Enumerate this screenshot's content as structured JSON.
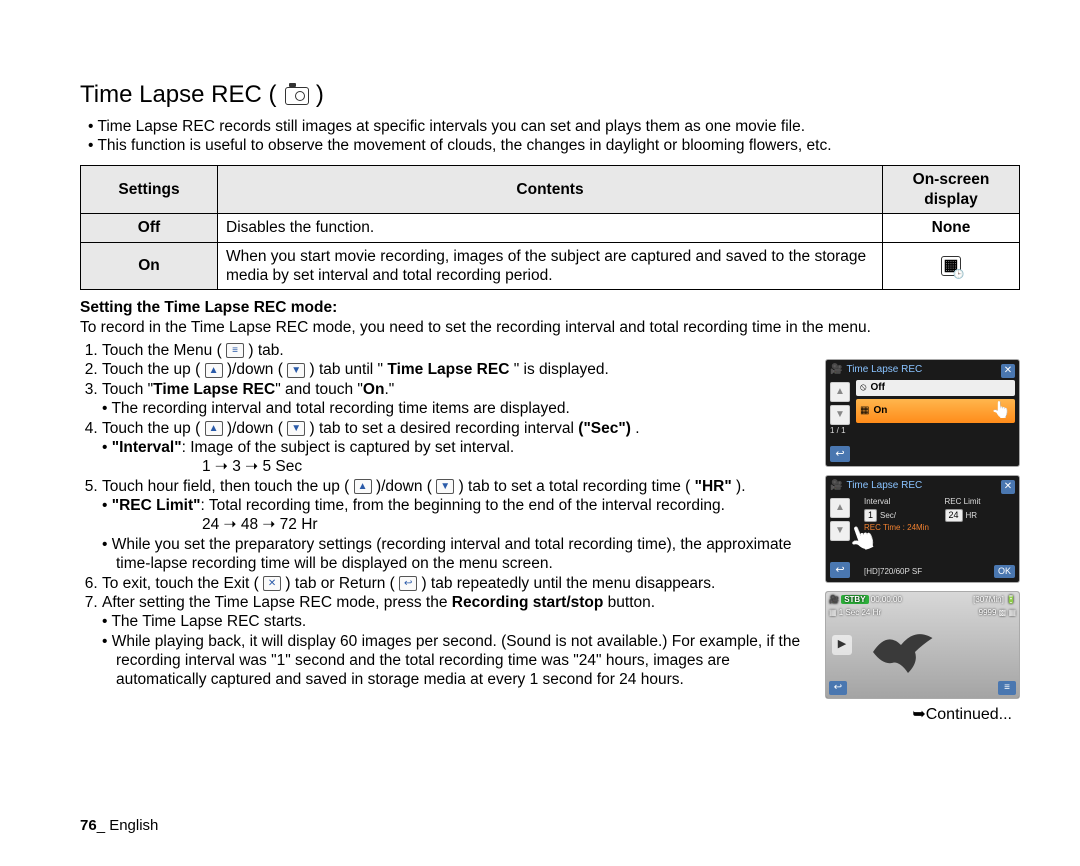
{
  "title": "Time Lapse REC (",
  "title_end": ")",
  "intro": [
    "Time Lapse REC records still images at specific intervals you can set and plays them as one movie file.",
    "This function is useful to observe the movement of clouds, the changes in daylight or blooming flowers, etc."
  ],
  "table": {
    "headers": [
      "Settings",
      "Contents",
      "On-screen display"
    ],
    "rows": [
      {
        "setting": "Off",
        "content": "Disables the function.",
        "display": "None"
      },
      {
        "setting": "On",
        "content": "When you start movie recording, images of the subject are captured and saved to the storage media by set interval and total recording period.",
        "display": "__icon__"
      }
    ]
  },
  "subhead": "Setting the Time Lapse REC mode:",
  "subtext": "To record in the Time Lapse REC mode, you need to set the recording interval and total recording time in the menu.",
  "steps": {
    "s1_a": "Touch the Menu (",
    "s1_b": ") tab.",
    "s2_a": "Touch the up (",
    "s2_b": ")/down (",
    "s2_c": ") tab until \"",
    "s2_bold": "Time Lapse REC",
    "s2_d": "\" is displayed.",
    "s3_a": "Touch \"",
    "s3_b1": "Time Lapse REC",
    "s3_b": "\" and touch \"",
    "s3_b2": "On",
    "s3_c": ".\"",
    "s3_sub": "The recording interval and total recording time items are displayed.",
    "s4_a": "Touch the up (",
    "s4_b": ")/down (",
    "s4_c": ") tab to set a desired recording interval ",
    "s4_bold": "(\"Sec\")",
    "s4_d": ".",
    "s4_sub_b": "\"Interval\"",
    "s4_sub": ": Image of the subject is captured by set interval.",
    "s4_seq": "1 ➝ 3 ➝ 5 Sec",
    "s5_a": "Touch hour field, then touch the up (",
    "s5_b": ")/down (",
    "s5_c": ") tab to set a total recording time (",
    "s5_bold": "\"HR\"",
    "s5_d": ").",
    "s5_sub_b": "\"REC Limit\"",
    "s5_sub": ": Total recording time, from the beginning to the end of the interval recording.",
    "s5_seq": "24 ➝ 48 ➝ 72 Hr",
    "s5_sub2": "While you set the preparatory settings (recording interval and total recording time), the approximate time-lapse recording time will be displayed on the menu screen.",
    "s6_a": "To exit, touch the Exit (",
    "s6_b": ") tab or Return (",
    "s6_c": ") tab repeatedly until the menu disappears.",
    "s7_a": "After setting the Time Lapse REC mode, press the ",
    "s7_bold": "Recording start/stop",
    "s7_b": " button.",
    "s7_sub1": "The Time Lapse REC starts.",
    "s7_sub2": "While playing back, it will display 60 images per second. (Sound is not available.) For example, if the recording interval was \"1\" second and the total recording time was \"24\" hours, images are automatically captured and saved in storage media at every 1 second for 24 hours."
  },
  "continued": "➥Continued...",
  "footer_page": "76",
  "footer_sep": "_ ",
  "footer_lang": "English",
  "shots": {
    "s1": {
      "title": "Time Lapse REC",
      "off": "Off",
      "on": "On",
      "page": "1 / 1"
    },
    "s2": {
      "title": "Time Lapse REC",
      "interval": "Interval",
      "reclimit": "REC Limit",
      "sec_val": "1",
      "sec_unit": "Sec/",
      "hr_val": "24",
      "hr_unit": "HR",
      "rectime": "REC Time : 24Min",
      "hd": "[HD]720/60P SF",
      "ok": "OK"
    },
    "s3": {
      "stby": "STBY",
      "time": "00:00:00",
      "min": "[307Min]",
      "battery": "",
      "sec": "1 Sec",
      "hr": "24 Hr",
      "count": "9999",
      "sf": ""
    }
  }
}
